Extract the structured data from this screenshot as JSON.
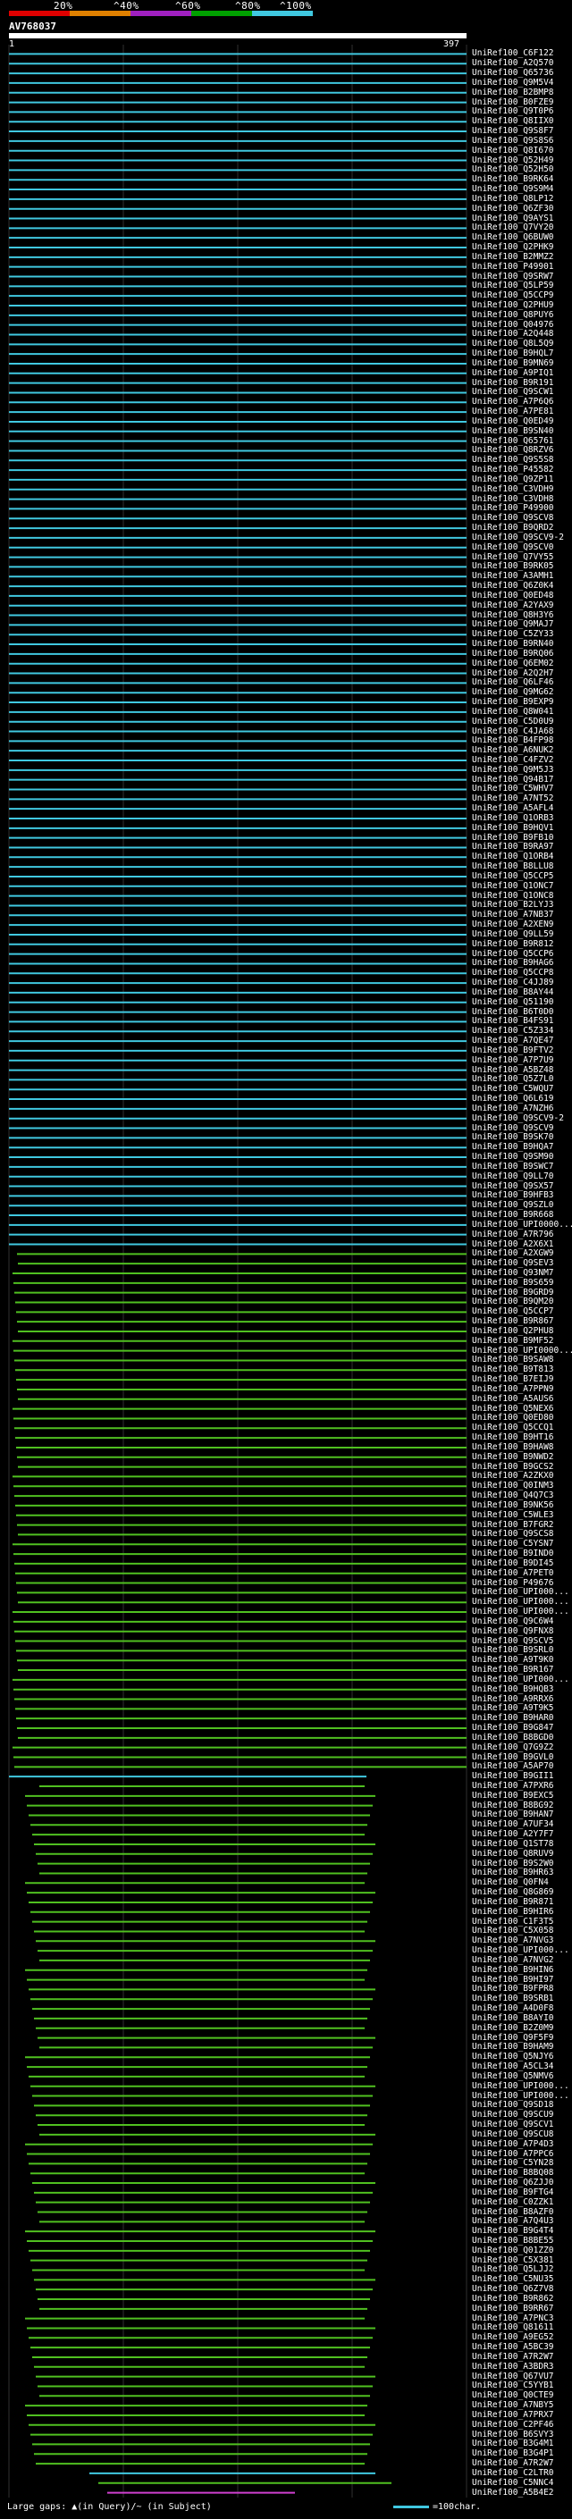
{
  "legend": {
    "labels": [
      "20%",
      "^40%",
      "^60%",
      "^80%",
      "^100%"
    ],
    "colors": [
      "#e00000",
      "#e08000",
      "#a020c0",
      "#00a000",
      "#40c8e0"
    ]
  },
  "query": {
    "name": "AV768037",
    "start": "1",
    "end": "397"
  },
  "hit_colors": {
    "cyan": "#40c8e0",
    "green": "#50c020",
    "magenta": "#d040d0"
  },
  "hits": [
    "UniRef100_C6F122",
    "UniRef100_A2Q570",
    "UniRef100_Q65736",
    "UniRef100_Q9M5V4",
    "UniRef100_B2BMP8",
    "UniRef100_B0FZE9",
    "UniRef100_Q9T0P6",
    "UniRef100_Q8IIX0",
    "UniRef100_Q9S8F7",
    "UniRef100_Q9S8S6",
    "UniRef100_Q8I670",
    "UniRef100_Q52H49",
    "UniRef100_Q52H50",
    "UniRef100_B9RK64",
    "UniRef100_Q9S9M4",
    "UniRef100_Q8LP12",
    "UniRef100_Q6ZF30",
    "UniRef100_Q9AYS1",
    "UniRef100_Q7VY20",
    "UniRef100_Q6BUW0",
    "UniRef100_Q2PHK9",
    "UniRef100_B2MMZ2",
    "UniRef100_P49901",
    "UniRef100_Q9SRW7",
    "UniRef100_Q5LP59",
    "UniRef100_Q5CCP9",
    "UniRef100_Q2PHU9",
    "UniRef100_Q8PUY6",
    "UniRef100_Q04976",
    "UniRef100_A2Q448",
    "UniRef100_Q8L5Q9",
    "UniRef100_B9HQL7",
    "UniRef100_B9MN69",
    "UniRef100_A9PIQ1",
    "UniRef100_B9R191",
    "UniRef100_Q9SCW1",
    "UniRef100_A7P6Q6",
    "UniRef100_A7PE81",
    "UniRef100_Q0ED49",
    "UniRef100_B9SN40",
    "UniRef100_Q65761",
    "UniRef100_Q8RZV6",
    "UniRef100_Q9S5S8",
    "UniRef100_P45582",
    "UniRef100_Q9ZP11",
    "UniRef100_C3VDH9",
    "UniRef100_C3VDH8",
    "UniRef100_P49900",
    "UniRef100_Q9SCV8",
    "UniRef100_B9QRD2",
    "UniRef100_Q9SCV9-2",
    "UniRef100_Q9SCV0",
    "UniRef100_Q7VY55",
    "UniRef100_B9RK05",
    "UniRef100_A3AMH1",
    "UniRef100_Q6Z0K4",
    "UniRef100_Q0ED48",
    "UniRef100_A2YAX9",
    "UniRef100_Q8H3Y6",
    "UniRef100_Q9MAJ7",
    "UniRef100_C5ZY33",
    "UniRef100_B9RN40",
    "UniRef100_B9RQ06",
    "UniRef100_Q6EM02",
    "UniRef100_A2Q2H7",
    "UniRef100_Q6LF46",
    "UniRef100_Q9MG62",
    "UniRef100_B9EXP9",
    "UniRef100_Q8W041",
    "UniRef100_C5D0U9",
    "UniRef100_C4JA68",
    "UniRef100_B4FP98",
    "UniRef100_A6NUK2",
    "UniRef100_C4FZV2",
    "UniRef100_Q9M5J3",
    "UniRef100_Q94B17",
    "UniRef100_C5WHV7",
    "UniRef100_A7NT52",
    "UniRef100_A5AFL4",
    "UniRef100_Q1ORB3",
    "UniRef100_B9HQV1",
    "UniRef100_B9FB10",
    "UniRef100_B9RA97",
    "UniRef100_Q1ORB4",
    "UniRef100_B8LLU8",
    "UniRef100_Q5CCP5",
    "UniRef100_Q1ONC7",
    "UniRef100_Q1ONC8",
    "UniRef100_B2LYJ3",
    "UniRef100_A7NB37",
    "UniRef100_A2XEN9",
    "UniRef100_Q9LL59",
    "UniRef100_B9R812",
    "UniRef100_Q5CCP6",
    "UniRef100_B9HAG6",
    "UniRef100_Q5CCP8",
    "UniRef100_C4JJ89",
    "UniRef100_B8AY44",
    "UniRef100_Q51190",
    "UniRef100_B6T0D0",
    "UniRef100_B4FS91",
    "UniRef100_C5Z334",
    "UniRef100_A7QE47",
    "UniRef100_B9FTV2",
    "UniRef100_A7P7U9",
    "UniRef100_A5BZ48",
    "UniRef100_Q5Z7L0",
    "UniRef100_C5WQU7",
    "UniRef100_Q6L619",
    "UniRef100_A7NZH6",
    "UniRef100_Q9SCV9-2",
    "UniRef100_Q9SCV9",
    "UniRef100_B9SK70",
    "UniRef100_B9HQA7",
    "UniRef100_Q9SM90",
    "UniRef100_B9SWC7",
    "UniRef100_Q9LL70",
    "UniRef100_Q9SX57",
    "UniRef100_B9HFB3",
    "UniRef100_Q9SZL0",
    "UniRef100_B9R668",
    "UniRef100_UPI0000...",
    "UniRef100_A7R796",
    "UniRef100_A2X6X1",
    "UniRef100_A2XGW9",
    "UniRef100_Q9SEV3",
    "UniRef100_Q93NM7",
    "UniRef100_B9S659",
    "UniRef100_B9GRD9",
    "UniRef100_B9QM20",
    "UniRef100_Q5CCP7",
    "UniRef100_B9R867",
    "UniRef100_Q2PHU8",
    "UniRef100_B9MF52",
    "UniRef100_UPI0000...",
    "UniRef100_B9SAW8",
    "UniRef100_B9T813",
    "UniRef100_B7EIJ9",
    "UniRef100_A7PPN9",
    "UniRef100_A5AUS6",
    "UniRef100_Q5NEX6",
    "UniRef100_Q0ED80",
    "UniRef100_Q5CCQ1",
    "UniRef100_B9HT16",
    "UniRef100_B9HAW8",
    "UniRef100_B9NWD2",
    "UniRef100_B9GCS2",
    "UniRef100_A2ZKX0",
    "UniRef100_Q0INM3",
    "UniRef100_Q4Q7C3",
    "UniRef100_B9NK56",
    "UniRef100_C5WLE3",
    "UniRef100_B7FGR2",
    "UniRef100_Q9SCS8",
    "UniRef100_C5YSN7",
    "UniRef100_B9IND0",
    "UniRef100_B9DI45",
    "UniRef100_A7PET0",
    "UniRef100_P49676",
    "UniRef100_UPI000...",
    "UniRef100_UPI000...",
    "UniRef100_UPI000...",
    "UniRef100_Q9C6W4",
    "UniRef100_Q9FNX8",
    "UniRef100_Q9SCV5",
    "UniRef100_B9SRL0",
    "UniRef100_A9T9K0",
    "UniRef100_B9R167",
    "UniRef100_UPI000...",
    "UniRef100_B9HQB3",
    "UniRef100_A9RRX6",
    "UniRef100_A9T9K5",
    "UniRef100_B9HAR0",
    "UniRef100_B9G847",
    "UniRef100_B8BGD0",
    "UniRef100_Q7G9Z2",
    "UniRef100_B9GVL0",
    "UniRef100_A5AP70",
    "UniRef100_B9GII1",
    "UniRef100_A7PXR6",
    "UniRef100_B9EXC5",
    "UniRef100_B8BG92",
    "UniRef100_B9HAN7",
    "UniRef100_A7UF34",
    "UniRef100_A2Y7F7",
    "UniRef100_Q1ST78",
    "UniRef100_Q8RUV9",
    "UniRef100_B9S2W0",
    "UniRef100_B9HR63",
    "UniRef100_Q0FN4",
    "UniRef100_Q8G869",
    "UniRef100_B9R871",
    "UniRef100_B9HIR6",
    "UniRef100_C1F3T5",
    "UniRef100_C5X058",
    "UniRef100_A7NVG3",
    "UniRef100_UPI000...",
    "UniRef100_A7NVG2",
    "UniRef100_B9HIN6",
    "UniRef100_B9HI97",
    "UniRef100_B9FPR8",
    "UniRef100_B9SRB1",
    "UniRef100_A4D0F8",
    "UniRef100_B8AYI0",
    "UniRef100_B2Z0M9",
    "UniRef100_Q9F5F9",
    "UniRef100_B9HAM9",
    "UniRef100_Q5NJY6",
    "UniRef100_A5CL34",
    "UniRef100_Q5NMV6",
    "UniRef100_UPI000...",
    "UniRef100_UPI000...",
    "UniRef100_Q9SD18",
    "UniRef100_Q9SCU9",
    "UniRef100_Q9SCV1",
    "UniRef100_Q9SCU8",
    "UniRef100_A7P4D3",
    "UniRef100_A7PPC6",
    "UniRef100_C5YN28",
    "UniRef100_B8BQ08",
    "UniRef100_Q6ZJJ0",
    "UniRef100_B9FTG4",
    "UniRef100_C0ZZK1",
    "UniRef100_B8AZF0",
    "UniRef100_A7Q4U3",
    "UniRef100_B9G4T4",
    "UniRef100_B8BE55",
    "UniRef100_Q01ZZ0",
    "UniRef100_C5X381",
    "UniRef100_Q5LJJ2",
    "UniRef100_C5NU35",
    "UniRef100_Q6Z7V8",
    "UniRef100_B9R862",
    "UniRef100_B9RR67",
    "UniRef100_A7PNC3",
    "UniRef100_Q81611",
    "UniRef100_A9EG52",
    "UniRef100_A5BC39",
    "UniRef100_A7R2W7",
    "UniRef100_A3BDR3",
    "UniRef100_Q67VU7",
    "UniRef100_C5YYB1",
    "UniRef100_Q0CTE9",
    "UniRef100_A7NBY5",
    "UniRef100_A7PRX7",
    "UniRef100_C2PF46",
    "UniRef100_B6SVY3",
    "UniRef100_B3G4M1",
    "UniRef100_B3G4P1",
    "UniRef100_A7R2W7",
    "UniRef100_C2LTR0",
    "UniRef100_C5NNC4",
    "UniRef100_A5B4E2"
  ],
  "footer": {
    "legend_text": "Large gaps: ▲(in Query)/~ (in Subject)",
    "scale_text": "=100char."
  }
}
